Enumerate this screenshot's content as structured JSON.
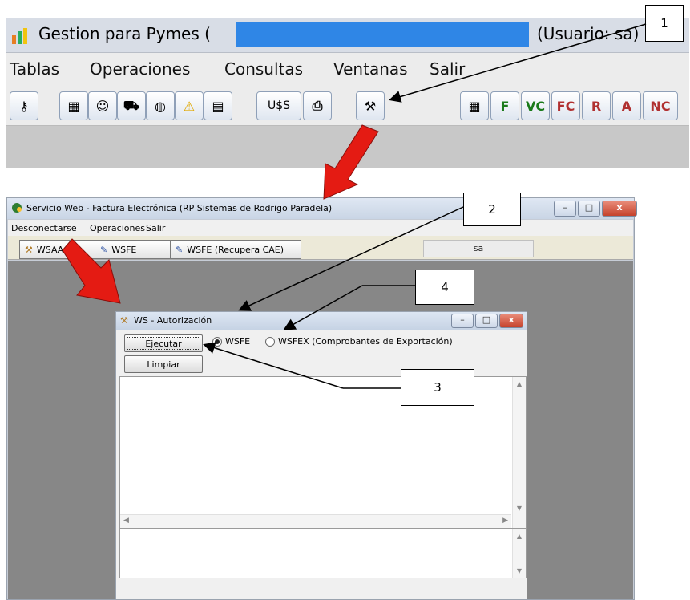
{
  "app": {
    "title": "Gestion para Pymes (",
    "user_label": "(Usuario: sa)",
    "menu": [
      "Tablas",
      "Operaciones",
      "Consultas",
      "Ventanas",
      "Salir"
    ],
    "toolbar_text_button": "U$S",
    "letter_buttons": [
      "F",
      "VC",
      "FC",
      "R",
      "A",
      "NC"
    ]
  },
  "ws_window": {
    "title": "Servicio Web - Factura Electrónica (RP Sistemas de Rodrigo Paradela)",
    "menu": [
      "Desconectarse",
      "Operaciones",
      "Salir"
    ],
    "buttons": [
      "WSAA",
      "WSFE",
      "WSFE (Recupera CAE)"
    ],
    "user_field": "sa"
  },
  "auth_dialog": {
    "title": "WS - Autorización",
    "execute_button": "Ejecutar",
    "clear_button": "Limpiar",
    "radio_wsfe": "WSFE",
    "radio_wsfex": "WSFEX (Comprobantes de Exportación)",
    "selected": "WSFE"
  },
  "callouts": [
    "1",
    "2",
    "3",
    "4"
  ],
  "colors": {
    "arrow_red": "#e41b13",
    "title_highlight": "#2f86e6"
  }
}
